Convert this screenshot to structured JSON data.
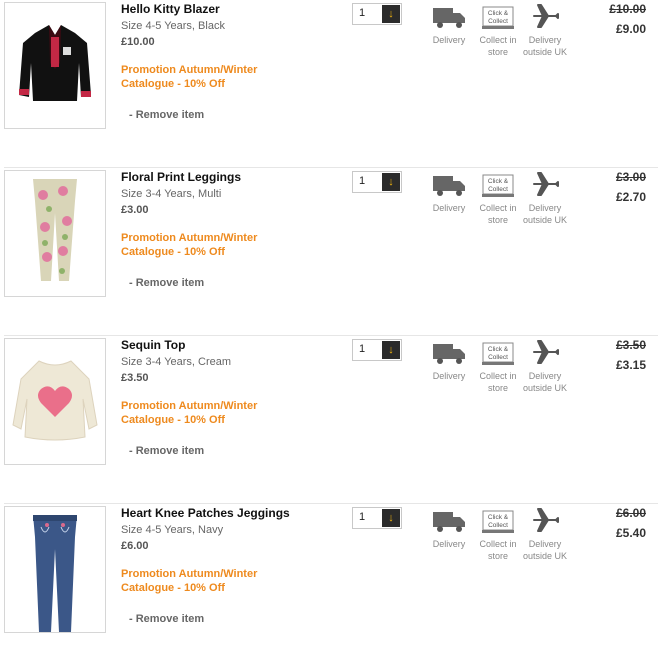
{
  "items": [
    {
      "name": "Hello Kitty Blazer",
      "size": "Size 4-5 Years, Black",
      "price": "£10.00",
      "promo": "Promotion Autumn/Winter Catalogue - 10% Off",
      "remove": "- Remove item",
      "qty": "1",
      "was": "£10.00",
      "now": "£9.00"
    },
    {
      "name": "Floral Print Leggings",
      "size": "Size 3-4 Years, Multi",
      "price": "£3.00",
      "promo": "Promotion Autumn/Winter Catalogue - 10% Off",
      "remove": "- Remove item",
      "qty": "1",
      "was": "£3.00",
      "now": "£2.70"
    },
    {
      "name": "Sequin Top",
      "size": "Size 3-4 Years, Cream",
      "price": "£3.50",
      "promo": "Promotion Autumn/Winter Catalogue - 10% Off",
      "remove": "- Remove item",
      "qty": "1",
      "was": "£3.50",
      "now": "£3.15"
    },
    {
      "name": "Heart Knee Patches Jeggings",
      "size": "Size 4-5 Years, Navy",
      "price": "£6.00",
      "promo": "Promotion Autumn/Winter Catalogue - 10% Off",
      "remove": "- Remove item",
      "qty": "1",
      "was": "£6.00",
      "now": "£5.40"
    }
  ],
  "delivery": {
    "delivery_label": "Delivery",
    "collect_label_1": "Collect in",
    "collect_label_2": "store",
    "collect_icon_text_1": "Click &",
    "collect_icon_text_2": "Collect",
    "outside_label_1": "Delivery",
    "outside_label_2": "outside UK"
  },
  "colors": {
    "promo": "#ee8a1e",
    "qty_arrow": "#f2b40f"
  }
}
